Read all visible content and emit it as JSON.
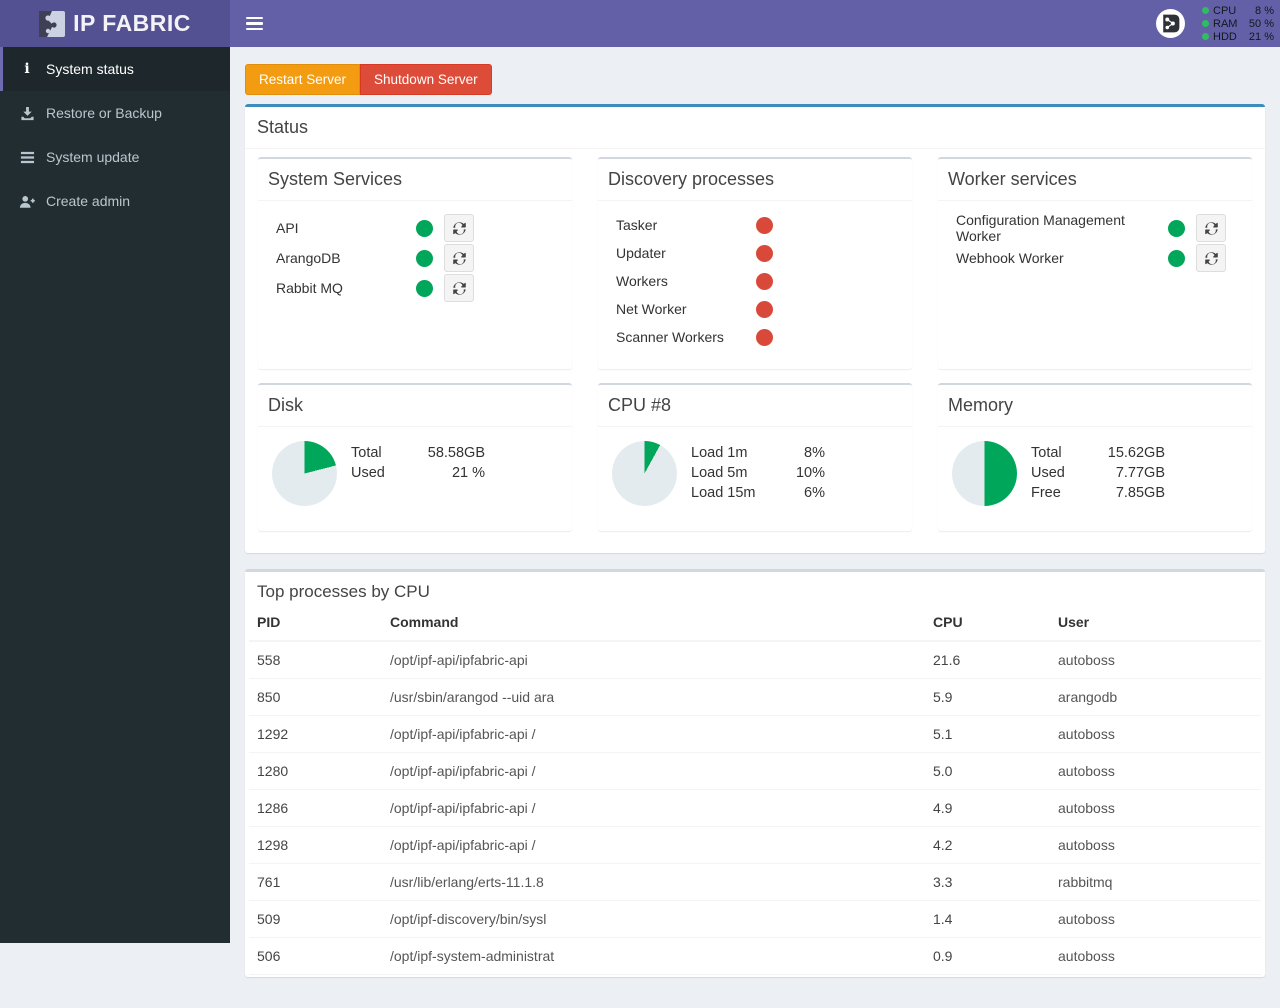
{
  "colors": {
    "navbar": "#6360a8",
    "brand_bg": "#545192",
    "sidebar": "#222d32",
    "green": "#00a65a",
    "red": "#d9493a",
    "orange": "#f39c12",
    "danger": "#dd4b39",
    "primary_border": "#3c8dbc",
    "pie_rest": "#e4ebee"
  },
  "header": {
    "brand": "IP FABRIC",
    "stats": [
      {
        "label": "CPU",
        "value": "8 %"
      },
      {
        "label": "RAM",
        "value": "50 %"
      },
      {
        "label": "HDD",
        "value": "21 %"
      }
    ]
  },
  "sidebar": {
    "items": [
      {
        "label": "System status"
      },
      {
        "label": "Restore or Backup"
      },
      {
        "label": "System update"
      },
      {
        "label": "Create admin"
      }
    ]
  },
  "actions": {
    "restart": "Restart Server",
    "shutdown": "Shutdown Server"
  },
  "status_panel": {
    "title": "Status",
    "system_services": {
      "title": "System Services",
      "items": [
        {
          "name": "API",
          "status": "green"
        },
        {
          "name": "ArangoDB",
          "status": "green"
        },
        {
          "name": "Rabbit MQ",
          "status": "green"
        }
      ]
    },
    "discovery": {
      "title": "Discovery processes",
      "items": [
        {
          "name": "Tasker",
          "status": "red"
        },
        {
          "name": "Updater",
          "status": "red"
        },
        {
          "name": "Workers",
          "status": "red"
        },
        {
          "name": "Net Worker",
          "status": "red"
        },
        {
          "name": "Scanner Workers",
          "status": "red"
        }
      ]
    },
    "worker": {
      "title": "Worker services",
      "items": [
        {
          "name": "Configuration Management Worker",
          "status": "green"
        },
        {
          "name": "Webhook Worker",
          "status": "green"
        }
      ]
    }
  },
  "chart_data": [
    {
      "type": "pie",
      "title": "Disk",
      "percent_used": 21,
      "rows": [
        {
          "label": "Total",
          "value": "58.58GB"
        },
        {
          "label": "Used",
          "value": "21 %"
        }
      ]
    },
    {
      "type": "pie",
      "title": "CPU #8",
      "percent_used": 8,
      "rows": [
        {
          "label": "Load 1m",
          "value": "8%"
        },
        {
          "label": "Load 5m",
          "value": "10%"
        },
        {
          "label": "Load 15m",
          "value": "6%"
        }
      ]
    },
    {
      "type": "pie",
      "title": "Memory",
      "percent_used": 50,
      "rows": [
        {
          "label": "Total",
          "value": "15.62GB"
        },
        {
          "label": "Used",
          "value": "7.77GB"
        },
        {
          "label": "Free",
          "value": "7.85GB"
        }
      ]
    }
  ],
  "processes": {
    "title": "Top processes by CPU",
    "columns": [
      "PID",
      "Command",
      "CPU",
      "User"
    ],
    "rows": [
      [
        "558",
        "/opt/ipf-api/ipfabric-api",
        "21.6",
        "autoboss"
      ],
      [
        "850",
        "/usr/sbin/arangod --uid ara",
        "5.9",
        "arangodb"
      ],
      [
        "1292",
        "/opt/ipf-api/ipfabric-api /",
        "5.1",
        "autoboss"
      ],
      [
        "1280",
        "/opt/ipf-api/ipfabric-api /",
        "5.0",
        "autoboss"
      ],
      [
        "1286",
        "/opt/ipf-api/ipfabric-api /",
        "4.9",
        "autoboss"
      ],
      [
        "1298",
        "/opt/ipf-api/ipfabric-api /",
        "4.2",
        "autoboss"
      ],
      [
        "761",
        "/usr/lib/erlang/erts-11.1.8",
        "3.3",
        "rabbitmq"
      ],
      [
        "509",
        "/opt/ipf-discovery/bin/sysl",
        "1.4",
        "autoboss"
      ],
      [
        "506",
        "/opt/ipf-system-administrat",
        "0.9",
        "autoboss"
      ]
    ]
  }
}
